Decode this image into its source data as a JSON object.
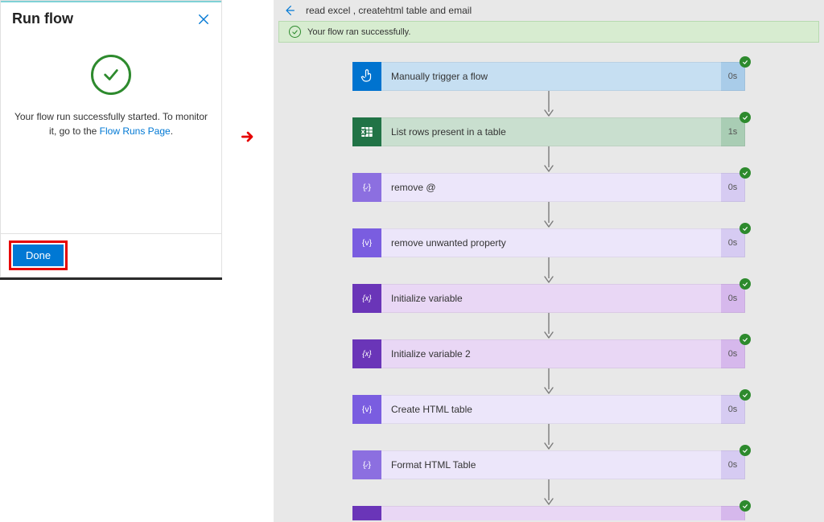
{
  "left": {
    "title": "Run flow",
    "message_pre": "Your flow run successfully started. To monitor it, go to the ",
    "link_text": "Flow Runs Page",
    "message_post": ".",
    "done_label": "Done"
  },
  "right": {
    "flow_title": "read excel , createhtml table and email",
    "success_msg": "Your flow ran successfully.",
    "steps": [
      {
        "label": "Manually trigger a flow",
        "duration": "0s",
        "variant": "v-trigger",
        "icon": "touch"
      },
      {
        "label": "List rows present in a table",
        "duration": "1s",
        "variant": "v-excel",
        "icon": "excel"
      },
      {
        "label": "remove @",
        "duration": "0s",
        "variant": "v-compose",
        "icon": "compose"
      },
      {
        "label": "remove unwanted property",
        "duration": "0s",
        "variant": "v-compose2",
        "icon": "compose-v"
      },
      {
        "label": "Initialize variable",
        "duration": "0s",
        "variant": "v-var",
        "icon": "var"
      },
      {
        "label": "Initialize variable 2",
        "duration": "0s",
        "variant": "v-var",
        "icon": "var"
      },
      {
        "label": "Create HTML table",
        "duration": "0s",
        "variant": "v-compose2",
        "icon": "compose-v"
      },
      {
        "label": "Format HTML Table",
        "duration": "0s",
        "variant": "v-compose",
        "icon": "compose"
      }
    ]
  }
}
